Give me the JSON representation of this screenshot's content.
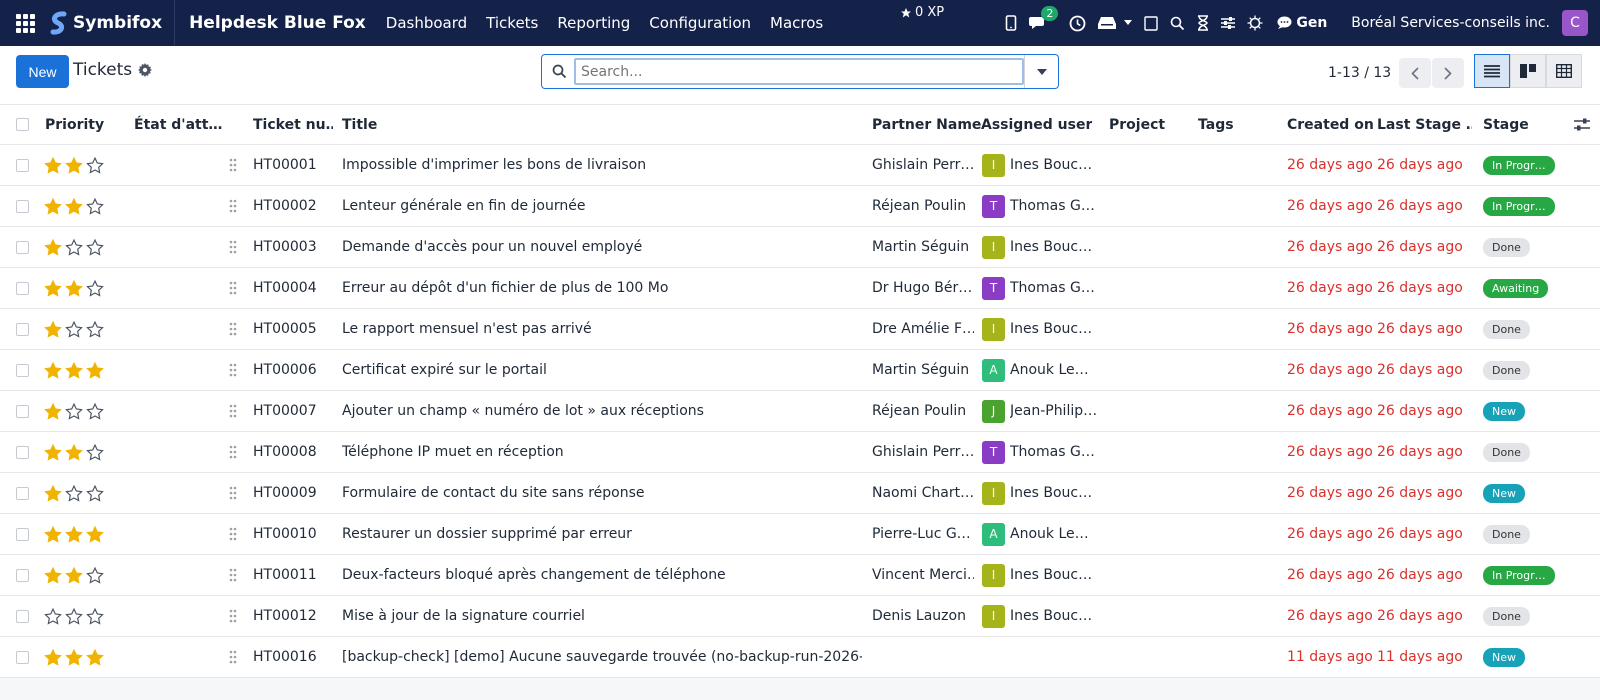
{
  "navbar": {
    "brand": "Symbifox",
    "app_name": "Helpdesk Blue Fox",
    "menu": [
      "Dashboard",
      "Tickets",
      "Reporting",
      "Configuration",
      "Macros"
    ],
    "xp": "0 XP",
    "chat_badge": "2",
    "gen_label": "Gen",
    "company": "Boréal Services-conseils inc.",
    "user_initial": "C",
    "colors": {
      "bg": "#14224a",
      "avatar": "#9856c9",
      "badge": "#1ea86b"
    }
  },
  "control_panel": {
    "new_label": "New",
    "breadcrumb": "Tickets",
    "search_placeholder": "Search...",
    "pager": "1-13 / 13"
  },
  "table": {
    "headers": {
      "priority": "Priority",
      "state": "État d'att…",
      "ticket_number": "Ticket nu…",
      "title": "Title",
      "partner": "Partner Name",
      "assigned": "Assigned user",
      "project": "Project",
      "tags": "Tags",
      "created": "Created on",
      "last_stage": "Last Stage …",
      "stage": "Stage"
    },
    "rows": [
      {
        "priority": 2,
        "number": "HT00001",
        "title": "Impossible d'imprimer les bons de livraison",
        "partner": "Ghislain Perr…",
        "avatar": "I",
        "avatar_color": "#a6b41b",
        "user": "Ines Bouch…",
        "created": "26 days ago",
        "last_stage": "26 days ago",
        "stage": "In Progr…",
        "stage_class": "b-progress"
      },
      {
        "priority": 2,
        "number": "HT00002",
        "title": "Lenteur générale en fin de journée",
        "partner": "Réjean Poulin",
        "avatar": "T",
        "avatar_color": "#8b3cc4",
        "user": "Thomas Gir…",
        "created": "26 days ago",
        "last_stage": "26 days ago",
        "stage": "In Progr…",
        "stage_class": "b-progress"
      },
      {
        "priority": 1,
        "number": "HT00003",
        "title": "Demande d'accès pour un nouvel employé",
        "partner": "Martin Séguin",
        "avatar": "I",
        "avatar_color": "#a6b41b",
        "user": "Ines Bouch…",
        "created": "26 days ago",
        "last_stage": "26 days ago",
        "stage": "Done",
        "stage_class": "b-done"
      },
      {
        "priority": 2,
        "number": "HT00004",
        "title": "Erreur au dépôt d'un fichier de plus de 100 Mo",
        "partner": "Dr Hugo Bér…",
        "avatar": "T",
        "avatar_color": "#8b3cc4",
        "user": "Thomas Gir…",
        "created": "26 days ago",
        "last_stage": "26 days ago",
        "stage": "Awaiting",
        "stage_class": "b-awaiting"
      },
      {
        "priority": 1,
        "number": "HT00005",
        "title": "Le rapport mensuel n'est pas arrivé",
        "partner": "Dre Amélie F…",
        "avatar": "I",
        "avatar_color": "#a6b41b",
        "user": "Ines Bouch…",
        "created": "26 days ago",
        "last_stage": "26 days ago",
        "stage": "Done",
        "stage_class": "b-done"
      },
      {
        "priority": 3,
        "number": "HT00006",
        "title": "Certificat expiré sur le portail",
        "partner": "Martin Séguin",
        "avatar": "A",
        "avatar_color": "#2ebd7a",
        "user": "Anouk Lemi…",
        "created": "26 days ago",
        "last_stage": "26 days ago",
        "stage": "Done",
        "stage_class": "b-done"
      },
      {
        "priority": 1,
        "number": "HT00007",
        "title": "Ajouter un champ « numéro de lot » aux réceptions",
        "partner": "Réjean Poulin",
        "avatar": "J",
        "avatar_color": "#4aa32e",
        "user": "Jean-Philip…",
        "created": "26 days ago",
        "last_stage": "26 days ago",
        "stage": "New",
        "stage_class": "b-new"
      },
      {
        "priority": 2,
        "number": "HT00008",
        "title": "Téléphone IP muet en réception",
        "partner": "Ghislain Perr…",
        "avatar": "T",
        "avatar_color": "#8b3cc4",
        "user": "Thomas Gir…",
        "created": "26 days ago",
        "last_stage": "26 days ago",
        "stage": "Done",
        "stage_class": "b-done"
      },
      {
        "priority": 1,
        "number": "HT00009",
        "title": "Formulaire de contact du site sans réponse",
        "partner": "Naomi Chart…",
        "avatar": "I",
        "avatar_color": "#a6b41b",
        "user": "Ines Bouch…",
        "created": "26 days ago",
        "last_stage": "26 days ago",
        "stage": "New",
        "stage_class": "b-new"
      },
      {
        "priority": 3,
        "number": "HT00010",
        "title": "Restaurer un dossier supprimé par erreur",
        "partner": "Pierre-Luc G…",
        "avatar": "A",
        "avatar_color": "#2ebd7a",
        "user": "Anouk Lemi…",
        "created": "26 days ago",
        "last_stage": "26 days ago",
        "stage": "Done",
        "stage_class": "b-done"
      },
      {
        "priority": 2,
        "number": "HT00011",
        "title": "Deux-facteurs bloqué après changement de téléphone",
        "partner": "Vincent Merci…",
        "avatar": "I",
        "avatar_color": "#a6b41b",
        "user": "Ines Bouch…",
        "created": "26 days ago",
        "last_stage": "26 days ago",
        "stage": "In Progr…",
        "stage_class": "b-progress"
      },
      {
        "priority": 0,
        "number": "HT00012",
        "title": "Mise à jour de la signature courriel",
        "partner": "Denis Lauzon",
        "avatar": "I",
        "avatar_color": "#a6b41b",
        "user": "Ines Bouch…",
        "created": "26 days ago",
        "last_stage": "26 days ago",
        "stage": "Done",
        "stage_class": "b-done"
      },
      {
        "priority": 3,
        "number": "HT00016",
        "title": "[backup-check] [demo] Aucune sauvegarde trouvée (no-backup-run-2026-…",
        "partner": "",
        "avatar": "",
        "avatar_color": "",
        "user": "",
        "created": "11 days ago",
        "last_stage": "11 days ago",
        "stage": "New",
        "stage_class": "b-new"
      }
    ]
  }
}
